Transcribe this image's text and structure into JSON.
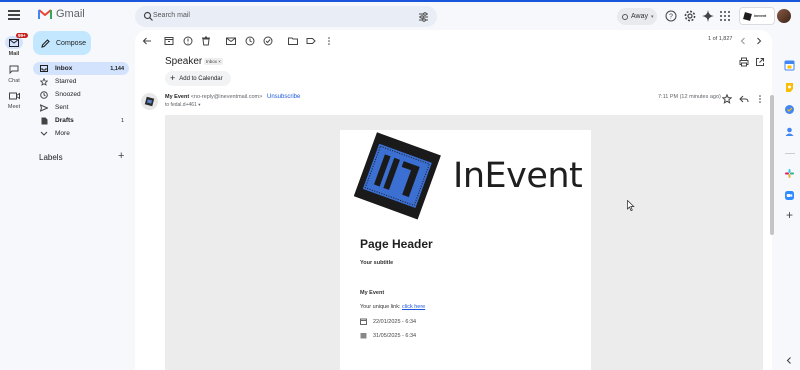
{
  "app": {
    "name": "Gmail"
  },
  "search": {
    "placeholder": "Search mail"
  },
  "status": {
    "label": "Away"
  },
  "account": {
    "brand_text": "inevent"
  },
  "rail": {
    "badge": "99+",
    "items": [
      {
        "label": "Mail"
      },
      {
        "label": "Chat"
      },
      {
        "label": "Meet"
      }
    ]
  },
  "sidebar": {
    "compose_label": "Compose",
    "items": [
      {
        "label": "Inbox",
        "count": "1,144",
        "active": true
      },
      {
        "label": "Starred",
        "count": ""
      },
      {
        "label": "Snoozed",
        "count": ""
      },
      {
        "label": "Sent",
        "count": ""
      },
      {
        "label": "Drafts",
        "count": "1"
      },
      {
        "label": "More",
        "count": ""
      }
    ],
    "labels_heading": "Labels"
  },
  "toolbar": {
    "pager": "1 of 1,827"
  },
  "email": {
    "subject": "Speaker",
    "inbox_chip": "Inbox ×",
    "add_calendar_label": "Add to Calendar",
    "sender_name": "My Event",
    "sender_email": "<no-reply@ineventmail.com>",
    "unsubscribe_label": "Unsubscribe",
    "to_line": "to fedal.d+461",
    "time": "7:11 PM (12 minutes ago)",
    "body": {
      "brand_name": "InEvent",
      "page_header": "Page Header",
      "subtitle": "Your subtitle",
      "event_name": "My Event",
      "unique_link_prefix": "Your unique link:",
      "unique_link_text": "click here",
      "start_date": "22/01/2025 - 6:34",
      "end_date": "31/05/2025 - 6:34"
    }
  },
  "colors": {
    "accent": "#1a56db",
    "compose_bg": "#c2e7ff",
    "active_nav": "#d3e3fd",
    "brand_blue": "#3b6fd1"
  }
}
